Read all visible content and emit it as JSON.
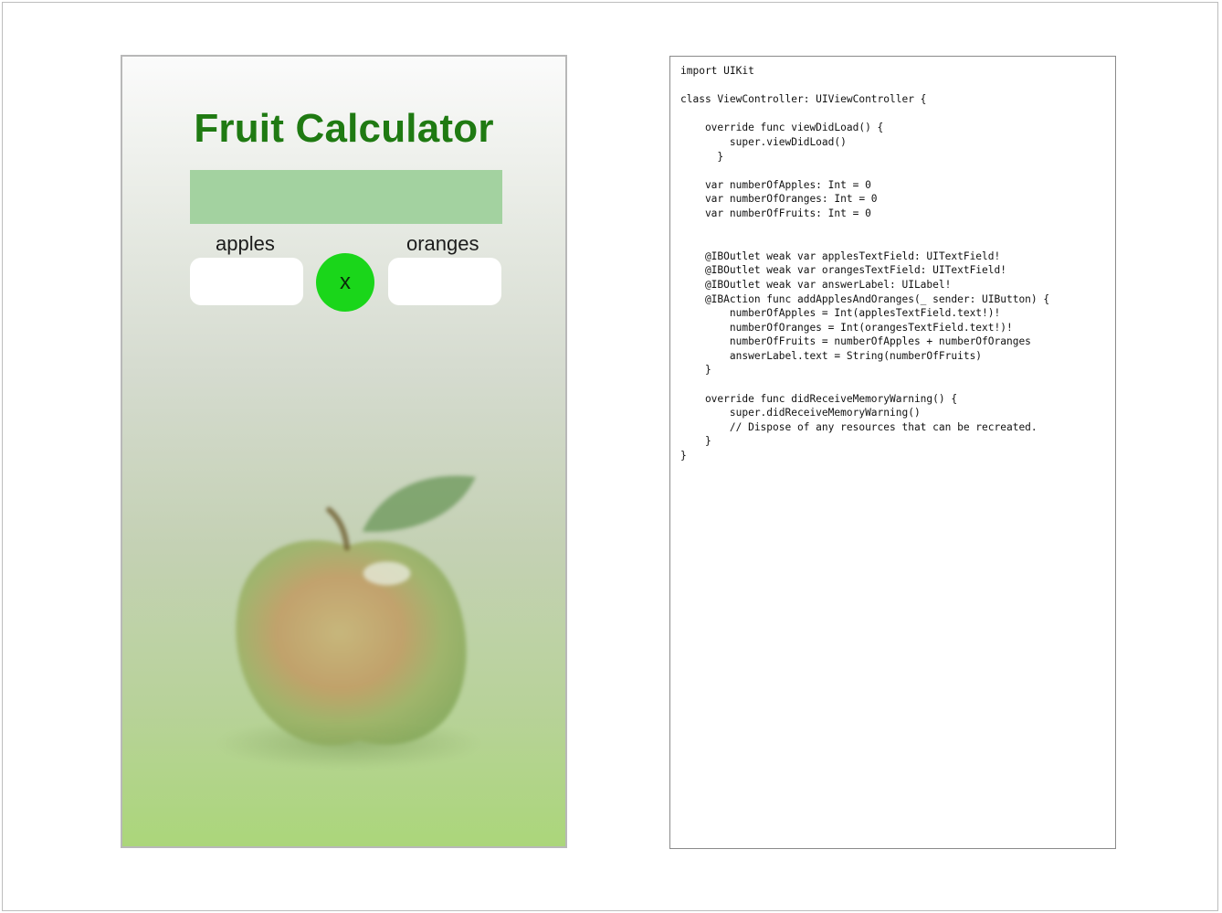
{
  "app": {
    "title": "Fruit Calculator",
    "answer_text": "",
    "apples_label": "apples",
    "oranges_label": "oranges",
    "apples_value": "",
    "oranges_value": "",
    "calculate_button_label": "x",
    "background_image": "apple-icon"
  },
  "code": {
    "lines": [
      "import UIKit",
      "",
      "class ViewController: UIViewController {",
      "",
      "    override func viewDidLoad() {",
      "        super.viewDidLoad()",
      "      }",
      "",
      "    var numberOfApples: Int = 0",
      "    var numberOfOranges: Int = 0",
      "    var numberOfFruits: Int = 0",
      "",
      "",
      "    @IBOutlet weak var applesTextField: UITextField!",
      "    @IBOutlet weak var orangesTextField: UITextField!",
      "    @IBOutlet weak var answerLabel: UILabel!",
      "    @IBAction func addApplesAndOranges(_ sender: UIButton) {",
      "        numberOfApples = Int(applesTextField.text!)!",
      "        numberOfOranges = Int(orangesTextField.text!)!",
      "        numberOfFruits = numberOfApples + numberOfOranges",
      "        answerLabel.text = String(numberOfFruits)",
      "    }",
      "",
      "    override func didReceiveMemoryWarning() {",
      "        super.didReceiveMemoryWarning()",
      "        // Dispose of any resources that can be recreated.",
      "    }",
      "}"
    ]
  },
  "colors": {
    "title_green": "#1f7a12",
    "answer_box": "#a3d2a0",
    "button_green": "#1ad61a"
  }
}
